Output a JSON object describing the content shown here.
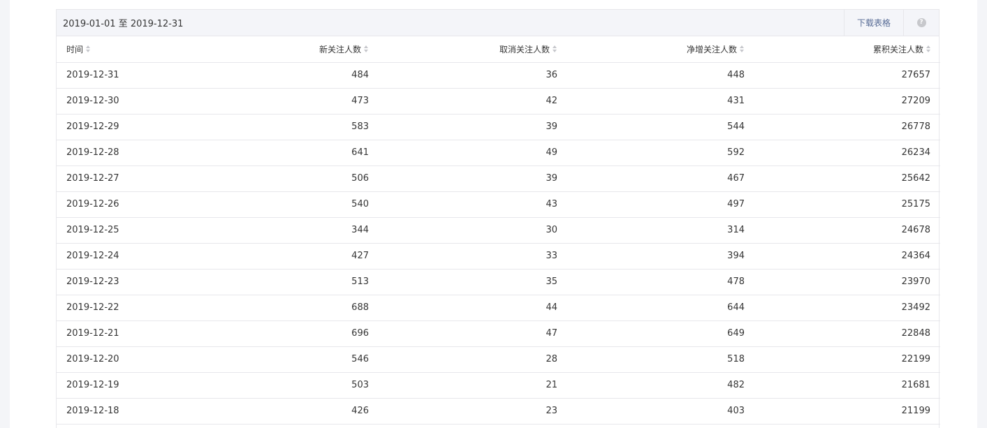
{
  "panel": {
    "date_range": "2019-01-01 至 2019-12-31",
    "download_label": "下载表格",
    "help_label": "?"
  },
  "table": {
    "columns": [
      "时间",
      "新关注人数",
      "取消关注人数",
      "净增关注人数",
      "累积关注人数"
    ],
    "rows": [
      [
        "2019-12-31",
        "484",
        "36",
        "448",
        "27657"
      ],
      [
        "2019-12-30",
        "473",
        "42",
        "431",
        "27209"
      ],
      [
        "2019-12-29",
        "583",
        "39",
        "544",
        "26778"
      ],
      [
        "2019-12-28",
        "641",
        "49",
        "592",
        "26234"
      ],
      [
        "2019-12-27",
        "506",
        "39",
        "467",
        "25642"
      ],
      [
        "2019-12-26",
        "540",
        "43",
        "497",
        "25175"
      ],
      [
        "2019-12-25",
        "344",
        "30",
        "314",
        "24678"
      ],
      [
        "2019-12-24",
        "427",
        "33",
        "394",
        "24364"
      ],
      [
        "2019-12-23",
        "513",
        "35",
        "478",
        "23970"
      ],
      [
        "2019-12-22",
        "688",
        "44",
        "644",
        "23492"
      ],
      [
        "2019-12-21",
        "696",
        "47",
        "649",
        "22848"
      ],
      [
        "2019-12-20",
        "546",
        "28",
        "518",
        "22199"
      ],
      [
        "2019-12-19",
        "503",
        "21",
        "482",
        "21681"
      ],
      [
        "2019-12-18",
        "426",
        "23",
        "403",
        "21199"
      ]
    ]
  },
  "colors": {
    "link": "#576b95",
    "border": "#e7e7eb",
    "header_bg": "#f4f5f9",
    "text": "#353535"
  }
}
